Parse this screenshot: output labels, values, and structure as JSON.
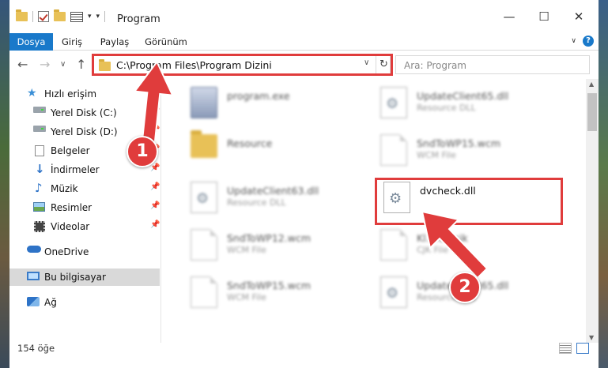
{
  "window": {
    "title": "Program",
    "controls": {
      "minimize": "—",
      "maximize": "☐",
      "close": "✕"
    }
  },
  "ribbon": {
    "tabs": [
      {
        "label": "Dosya",
        "active": true
      },
      {
        "label": "Giriş",
        "active": false
      },
      {
        "label": "Paylaş",
        "active": false
      },
      {
        "label": "Görünüm",
        "active": false
      }
    ],
    "help": "?"
  },
  "address": {
    "path": "C:\\Program Files\\Program Dizini",
    "search_placeholder": "Ara: Program"
  },
  "sidebar": {
    "items": [
      {
        "label": "Hızlı erişim",
        "icon": "star-icon"
      },
      {
        "label": "Yerel Disk (C:)",
        "icon": "drive-icon",
        "pinned": true
      },
      {
        "label": "Yerel Disk (D:)",
        "icon": "drive-icon",
        "pinned": true
      },
      {
        "label": "Belgeler",
        "icon": "document-icon",
        "pinned": true
      },
      {
        "label": "İndirmeler",
        "icon": "download-icon",
        "pinned": true
      },
      {
        "label": "Müzik",
        "icon": "music-icon",
        "pinned": true
      },
      {
        "label": "Resimler",
        "icon": "pictures-icon",
        "pinned": true
      },
      {
        "label": "Videolar",
        "icon": "video-icon",
        "pinned": true
      },
      {
        "label": "OneDrive",
        "icon": "cloud-icon"
      },
      {
        "label": "Bu bilgisayar",
        "icon": "computer-icon",
        "selected": true
      },
      {
        "label": "Ağ",
        "icon": "network-icon"
      }
    ]
  },
  "files": [
    {
      "name": "program.exe",
      "type": ""
    },
    {
      "name": "UpdateClient65.dll",
      "type": "Resource DLL"
    },
    {
      "name": "Resource",
      "type": ""
    },
    {
      "name": "SndToWP15.wcm",
      "type": "WCM File"
    },
    {
      "name": "UpdateClient63.dll",
      "type": "Resource DLL"
    },
    {
      "name": "dvcheck.dll",
      "type": ""
    },
    {
      "name": "SndToWP12.wcm",
      "type": "WCM File"
    },
    {
      "name": "Kl....en.cjk",
      "type": "CJK File"
    },
    {
      "name": "SndToWP15.wcm",
      "type": "WCM File"
    },
    {
      "name": "UpdateClient65.dll",
      "type": "Resource DLL"
    }
  ],
  "status": {
    "count": "154 öğe"
  },
  "annotations": {
    "badge1": "1",
    "badge2": "2",
    "color": "#e03c3c"
  }
}
